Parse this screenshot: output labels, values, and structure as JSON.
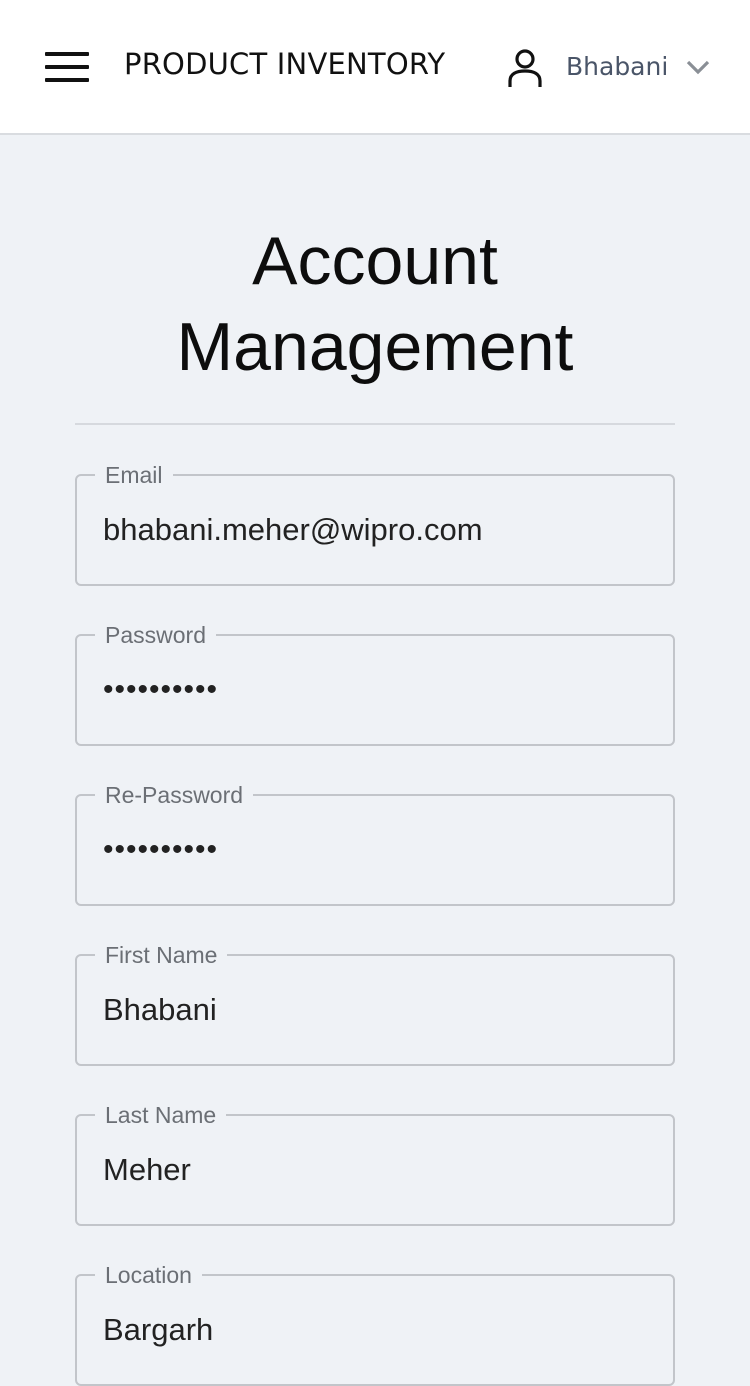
{
  "header": {
    "app_title": "PRODUCT INVENTORY",
    "menu_icon": "hamburger-menu-icon",
    "user_icon": "user-icon",
    "user_name": "Bhabani",
    "dropdown_icon": "chevron-down-icon"
  },
  "page": {
    "title_line1": "Account",
    "title_line2": "Management"
  },
  "form": {
    "fields": [
      {
        "label": "Email",
        "value": "bhabani.meher@wipro.com"
      },
      {
        "label": "Password",
        "value": "••••••••••"
      },
      {
        "label": "Re-Password",
        "value": "••••••••••"
      },
      {
        "label": "First Name",
        "value": "Bhabani"
      },
      {
        "label": "Last Name",
        "value": "Meher"
      },
      {
        "label": "Location",
        "value": "Bargarh"
      }
    ]
  },
  "colors": {
    "background": "#eff2f6",
    "header_background": "#ffffff",
    "username_text": "#4a5568",
    "field_border": "#c2c5ca"
  }
}
